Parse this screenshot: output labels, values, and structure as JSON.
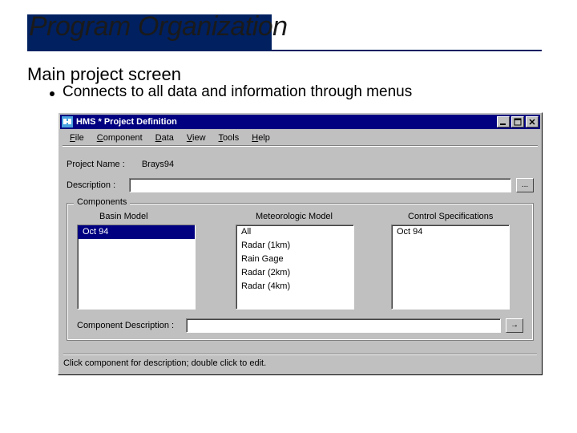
{
  "slide": {
    "title": "Program Organization",
    "heading": "Main project screen",
    "bullet": "Connects to all data and information through menus"
  },
  "window": {
    "title": "HMS * Project Definition",
    "menus": [
      "File",
      "Component",
      "Data",
      "View",
      "Tools",
      "Help"
    ],
    "projectNameLabel": "Project Name :",
    "projectName": "Brays94",
    "descriptionLabel": "Description :",
    "descriptionValue": "",
    "ellipsis": "...",
    "componentsLegend": "Components",
    "columns": {
      "basin": "Basin Model",
      "met": "Meteorologic Model",
      "ctrl": "Control Specifications"
    },
    "basinItems": [
      "Oct 94"
    ],
    "metItems": [
      "All",
      "Radar (1km)",
      "Rain Gage",
      "Radar (2km)",
      "Radar (4km)"
    ],
    "ctrlItems": [
      "Oct 94"
    ],
    "compDescLabel": "Component Description :",
    "compDescValue": "",
    "goArrow": "→",
    "status": "Click component for description; double click to edit."
  }
}
